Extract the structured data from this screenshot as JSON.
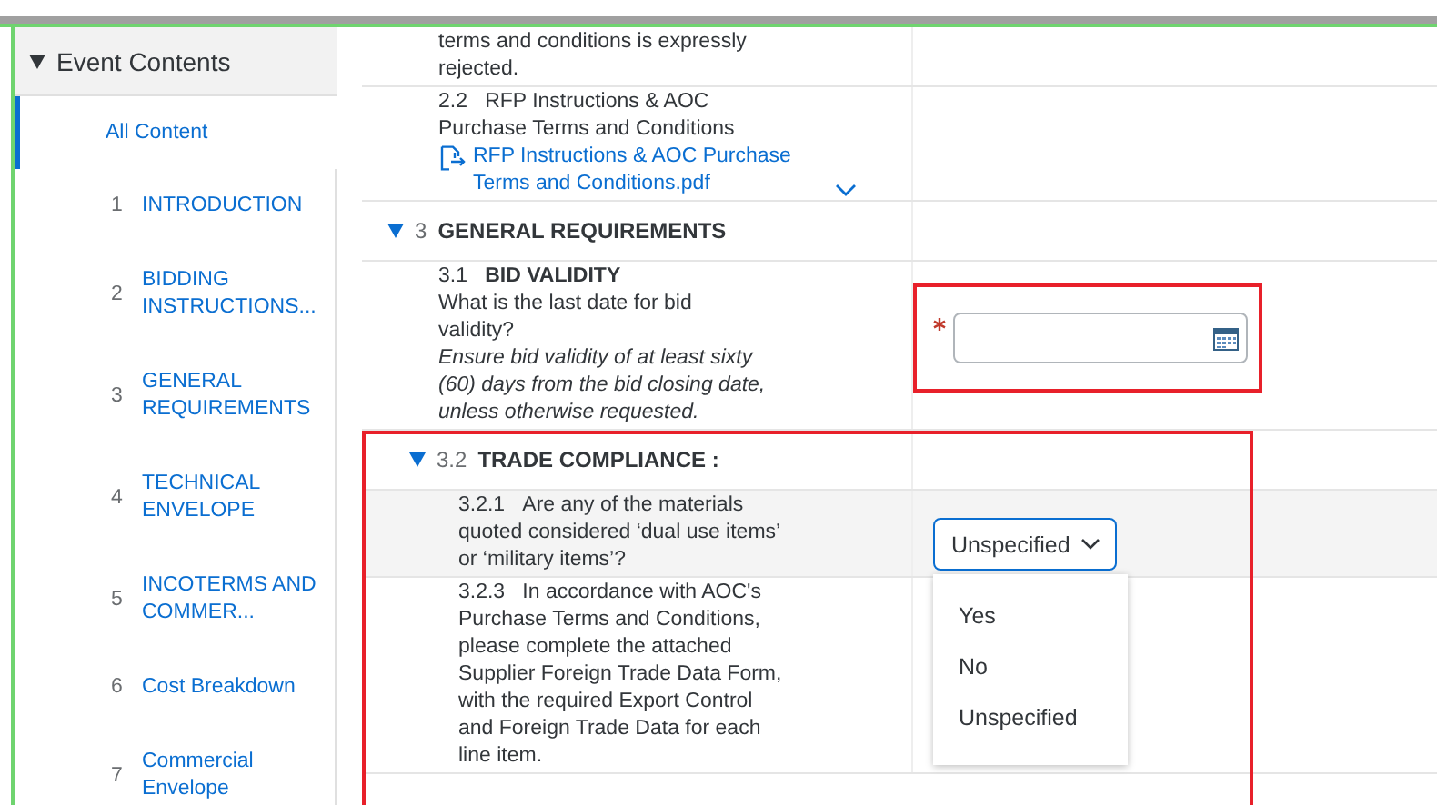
{
  "sidebar": {
    "title": "Event Contents",
    "expanded": true,
    "items": [
      {
        "label": "All Content",
        "selected": true
      },
      {
        "number": "1",
        "label": "INTRODUCTION",
        "selected": false
      },
      {
        "number": "2",
        "label": "BIDDING INSTRUCTIONS...",
        "selected": false
      },
      {
        "number": "3",
        "label": "GENERAL REQUIREMENTS",
        "selected": false
      },
      {
        "number": "4",
        "label": "TECHNICAL ENVELOPE",
        "selected": false
      },
      {
        "number": "5",
        "label": "INCOTERMS AND COMMER...",
        "selected": false
      },
      {
        "number": "6",
        "label": "Cost Breakdown",
        "selected": false
      },
      {
        "number": "7",
        "label": "Commercial Envelope",
        "selected": false
      }
    ]
  },
  "rows": [
    {
      "kind": "text",
      "text": "terms and conditions is expressly rejected."
    },
    {
      "kind": "attachment",
      "number": "2.2",
      "text": "RFP Instructions & AOC Purchase Terms and Conditions",
      "link": "RFP Instructions & AOC Purchase Terms and Conditions.pdf"
    },
    {
      "kind": "section",
      "number": "3",
      "title": "GENERAL REQUIREMENTS",
      "expanded": true,
      "flagged": false,
      "children": [
        {
          "kind": "question",
          "number": "3.1",
          "title": "BID VALIDITY",
          "text": "What is the last date for bid validity?",
          "note": "Ensure bid validity of at least sixty (60) days from the bid closing date, unless otherwise requested.",
          "shaded": false,
          "answer": {
            "kind": "date",
            "required": true,
            "flagged": true
          }
        },
        {
          "kind": "section",
          "number": "3.2",
          "title": "TRADE COMPLIANCE :",
          "expanded": true,
          "flagged": true,
          "children": [
            {
              "kind": "question",
              "number": "3.2.1",
              "text": "Are any of the materials quoted considered ‘dual use items’ or ‘military items’?",
              "shaded": true,
              "answer": {
                "kind": "select",
                "value": "Unspecified",
                "open": true,
                "options": [
                  "Yes",
                  "No",
                  "Unspecified"
                ]
              }
            },
            {
              "kind": "question",
              "number": "3.2.3",
              "text": "In accordance with AOC's Purchase Terms and Conditions, please complete the attached Supplier Foreign Trade Data Form, with the required Export Control and Foreign Trade Data for each line item.",
              "shaded": false
            }
          ]
        }
      ]
    }
  ]
}
